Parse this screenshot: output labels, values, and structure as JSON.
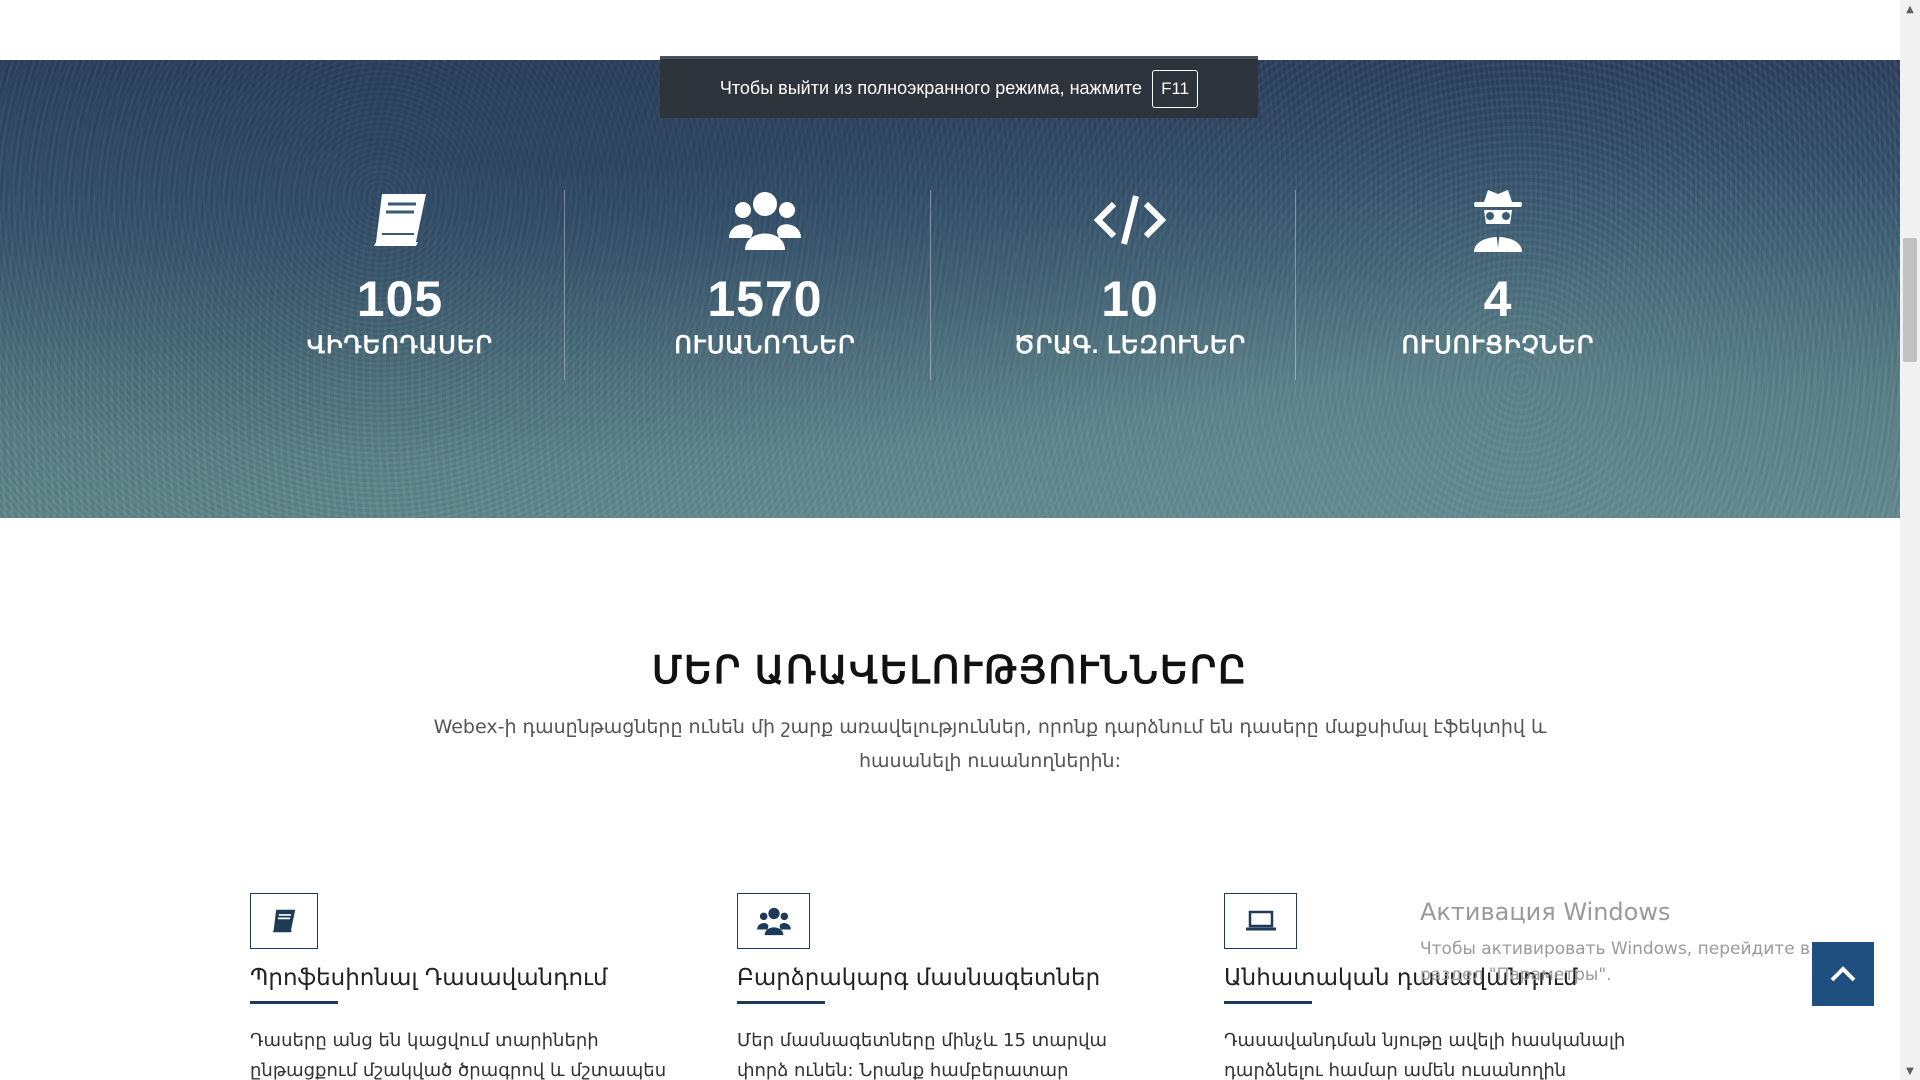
{
  "fullscreen_notice": {
    "text": "Чтобы выйти из полноэкранного режима, нажмите",
    "key": "F11"
  },
  "stats": [
    {
      "icon": "book-icon",
      "number": "105",
      "label": "ՎԻԴԵՈԴԱՍԵՐ"
    },
    {
      "icon": "users-icon",
      "number": "1570",
      "label": "ՈՒՍԱՆՈՂՆԵՐ"
    },
    {
      "icon": "code-icon",
      "number": "10",
      "label": "ԾՐԱԳ. ԼԵԶՈՒՆԵՐ"
    },
    {
      "icon": "spy-icon",
      "number": "4",
      "label": "ՈՒՍՈՒՑԻՉՆԵՐ"
    }
  ],
  "advantages": {
    "title": "ՄԵՐ ԱՌԱՎԵԼՈՒԹՅՈՒՆՆԵՐԸ",
    "subtitle": "Webex-ի դասընթացները ունեն մի շարք առավելություններ, որոնք դարձնում են դասերը մաքսիմալ էֆեկտիվ և հասանելի ուսանողներին:",
    "cards": [
      {
        "icon": "book-icon",
        "title": "Պրոֆեսիոնալ Դասավանդում",
        "text": "Դասերը անց են կացվում տարիների ընթացքում մշակված ծրագրով և մշտապես"
      },
      {
        "icon": "users-icon",
        "title": "Բարձրակարգ մասնագետներ",
        "text": "Մեր մասնագետները մինչև 15 տարվա փորձ ունեն: Նրանք համբերատար նկատառելով"
      },
      {
        "icon": "laptop-icon",
        "title": "Անհատական դասավանդում",
        "text": "Դասավանդման նյութը ավելի հասկանալի դարձնելու համար ամեն ուսանողին"
      }
    ]
  },
  "windows_activation": {
    "title": "Активация Windows",
    "text": "Чтобы активировать Windows, перейдите в раздел \"Параметры\"."
  },
  "colors": {
    "accent": "#1f4f7f",
    "icon_border": "#1f3a57",
    "hero_top": "#2c4060",
    "hero_bottom": "#5f868a"
  }
}
